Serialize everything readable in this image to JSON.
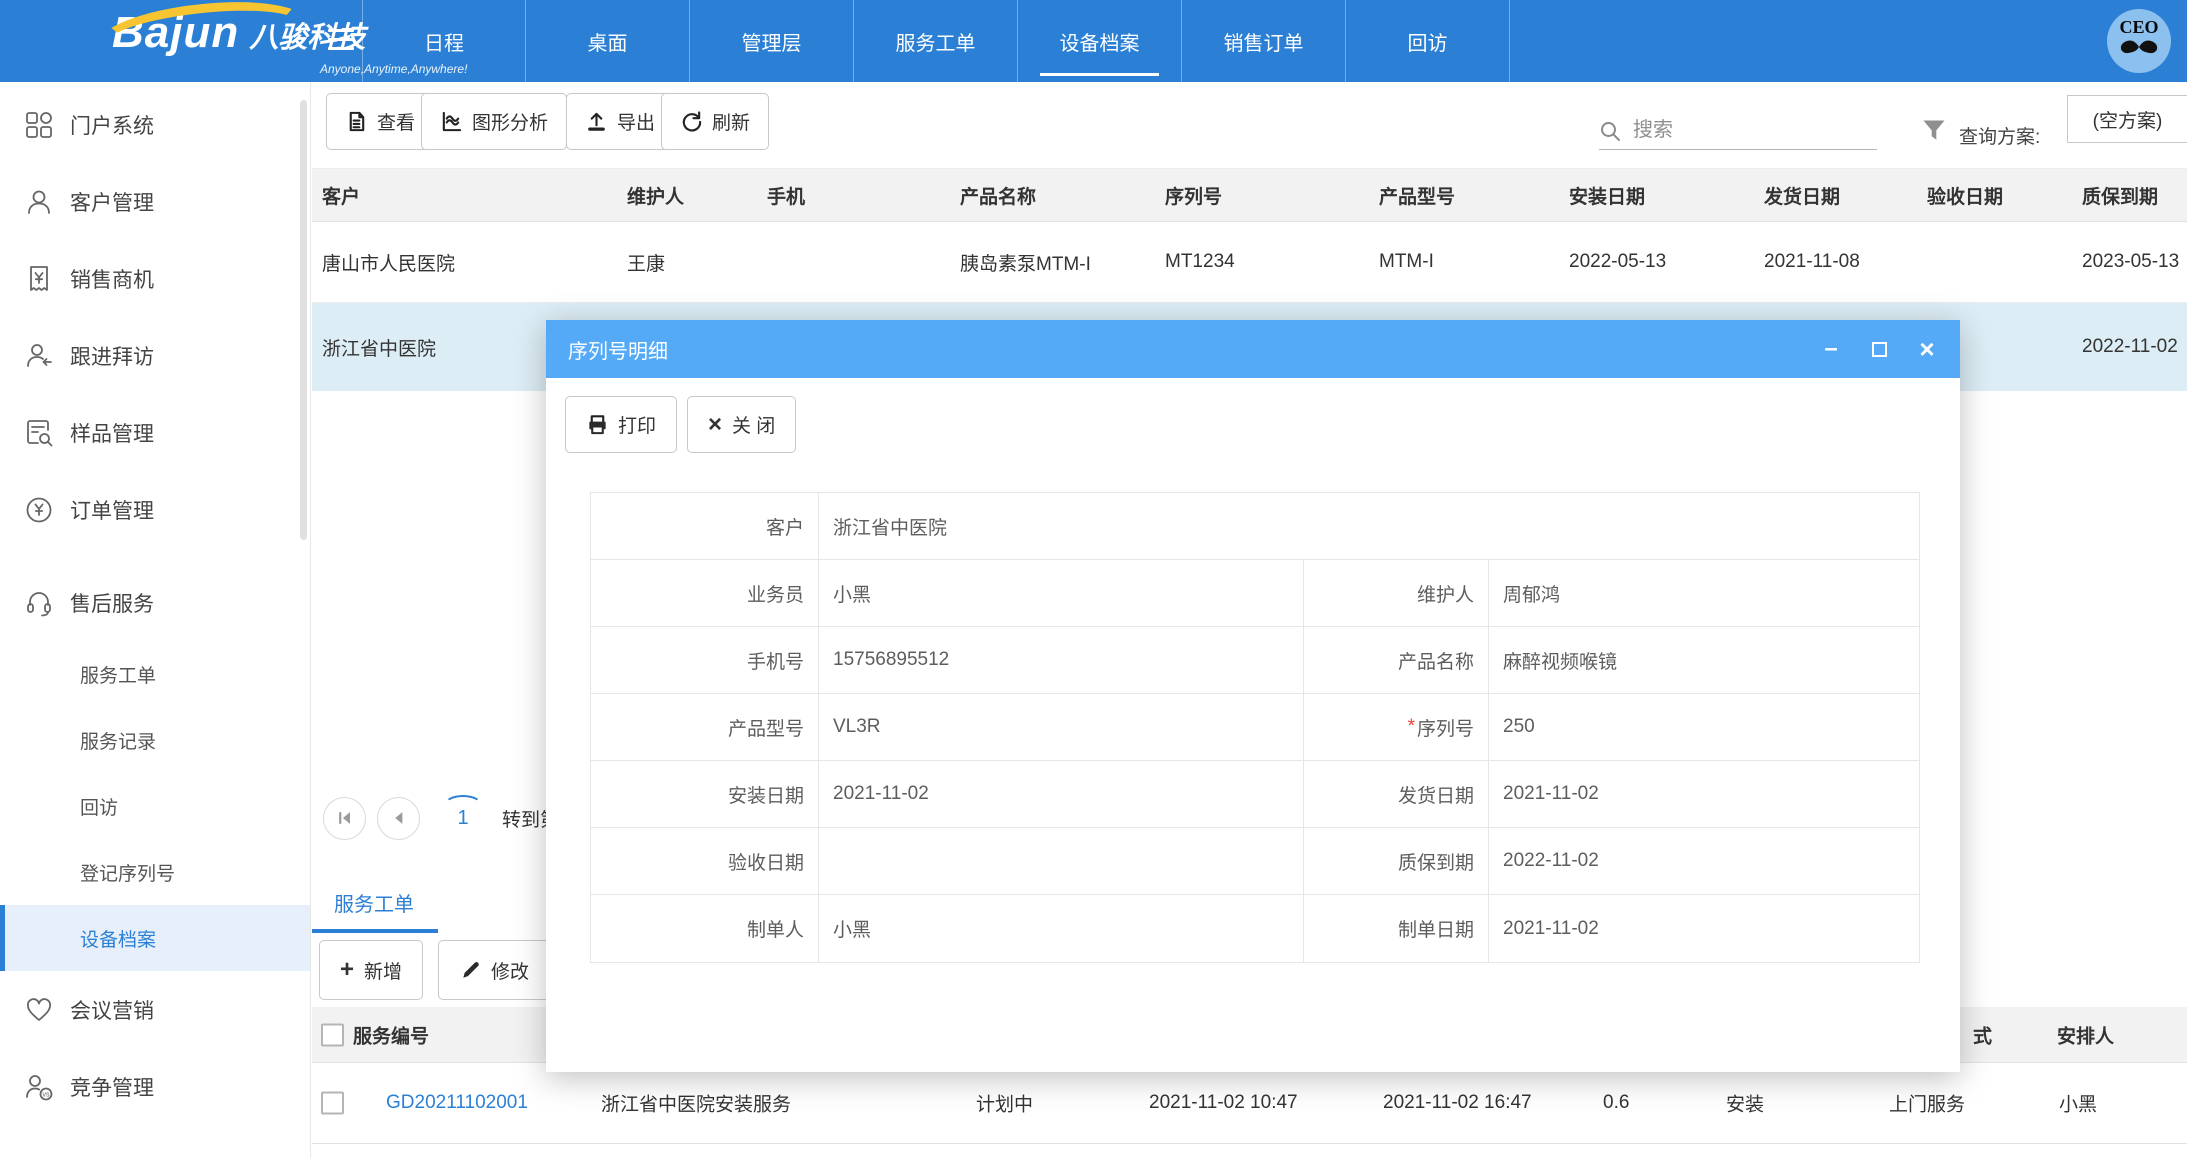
{
  "colors": {
    "accent": "#2b80d5",
    "modal_titlebar": "#55aaf7",
    "selected_row": "#ddedf5",
    "logo_swoosh": "#f6c531"
  },
  "icons": {
    "minimize": "–",
    "close_x": "×",
    "plus": "+",
    "button_close_x": "×"
  },
  "navbar": {
    "brand": "Bajun",
    "brand_cn": "八骏科技",
    "tagline": "Anyone,Anytime,Anywhere!",
    "items": [
      {
        "label": "日程"
      },
      {
        "label": "桌面"
      },
      {
        "label": "管理层"
      },
      {
        "label": "服务工单"
      },
      {
        "label": "设备档案"
      },
      {
        "label": "销售订单"
      },
      {
        "label": "回访"
      }
    ],
    "avatar_text": "CEO"
  },
  "sidebar": {
    "items": [
      {
        "label": "门户系统"
      },
      {
        "label": "客户管理"
      },
      {
        "label": "销售商机"
      },
      {
        "label": "跟进拜访"
      },
      {
        "label": "样品管理"
      },
      {
        "label": "订单管理"
      },
      {
        "label": "售后服务",
        "children": [
          "服务工单",
          "服务记录",
          "回访",
          "登记序列号",
          "设备档案"
        ],
        "active_child": "设备档案"
      },
      {
        "label": "会议营销"
      },
      {
        "label": "竞争管理"
      }
    ]
  },
  "toolbar": {
    "view": "查看",
    "chart": "图形分析",
    "export": "导出",
    "refresh": "刷新",
    "search_placeholder": "搜索",
    "plan_label": "查询方案:",
    "plan_value": "(空方案)"
  },
  "device_table": {
    "columns": [
      "客户",
      "维护人",
      "手机",
      "产品名称",
      "序列号",
      "产品型号",
      "安装日期",
      "发货日期",
      "验收日期",
      "质保到期"
    ],
    "rows": [
      [
        "唐山市人民医院",
        "王康",
        "",
        "胰岛素泵MTM-I",
        "MT1234",
        "MTM-I",
        "2022-05-13",
        "2021-11-08",
        "",
        "2023-05-13"
      ],
      [
        "浙江省中医院",
        "",
        "",
        "",
        "",
        "",
        "",
        "",
        "",
        "2022-11-02"
      ]
    ]
  },
  "pagination": {
    "page": "1",
    "goto_label": "转到第"
  },
  "subtab": {
    "label": "服务工单"
  },
  "sub_toolbar": {
    "add": "新增",
    "edit": "修改"
  },
  "service_table": {
    "header": {
      "id": "服务编号",
      "mode_partial": "式",
      "assignee": "安排人"
    },
    "row": {
      "id": "GD20211102001",
      "name": "浙江省中医院安装服务",
      "status": "计划中",
      "start": "2021-11-02 10:47",
      "end": "2021-11-02 16:47",
      "hours": "0.6",
      "type": "安装",
      "mode": "上门服务",
      "assignee": "小黑"
    }
  },
  "modal": {
    "title": "序列号明细",
    "toolbar": {
      "print": "打印",
      "close": "关 闭"
    },
    "rows": [
      {
        "l1": "客户",
        "v1": "浙江省中医院"
      },
      {
        "l1": "业务员",
        "v1": "小黑",
        "l2": "维护人",
        "v2": "周郁鸿"
      },
      {
        "l1": "手机号",
        "v1": "15756895512",
        "l2": "产品名称",
        "v2": "麻醉视频喉镜"
      },
      {
        "l1": "产品型号",
        "v1": "VL3R",
        "l2": "序列号",
        "v2": "250",
        "required2": "*"
      },
      {
        "l1": "安装日期",
        "v1": "2021-11-02",
        "l2": "发货日期",
        "v2": "2021-11-02"
      },
      {
        "l1": "验收日期",
        "v1": "",
        "l2": "质保到期",
        "v2": "2022-11-02"
      },
      {
        "l1": "制单人",
        "v1": "小黑",
        "l2": "制单日期",
        "v2": "2021-11-02"
      }
    ]
  }
}
